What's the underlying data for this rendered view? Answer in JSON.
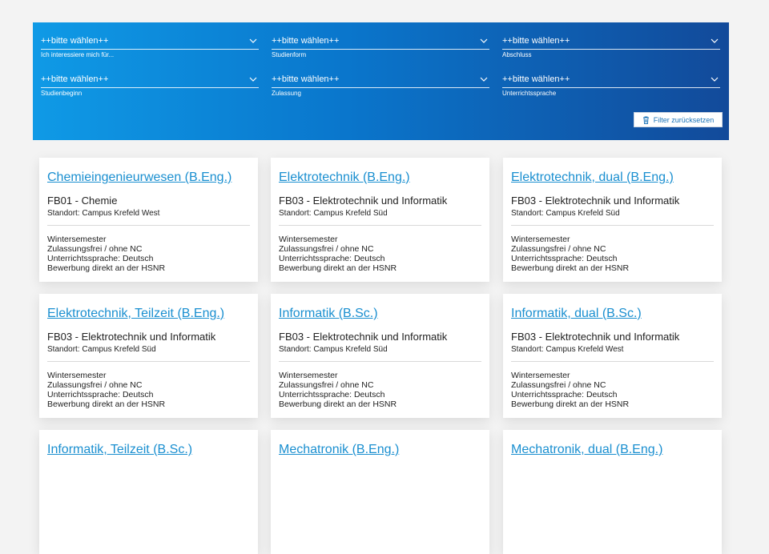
{
  "filters": [
    {
      "value": "++bitte wählen++",
      "label": "Ich interessiere mich für..."
    },
    {
      "value": "++bitte wählen++",
      "label": "Studienform"
    },
    {
      "value": "++bitte wählen++",
      "label": "Abschluss"
    },
    {
      "value": "++bitte wählen++",
      "label": "Studienbeginn"
    },
    {
      "value": "++bitte wählen++",
      "label": "Zulassung"
    },
    {
      "value": "++bitte wählen++",
      "label": "Unterrichtssprache"
    }
  ],
  "reset_button": {
    "label": "Filter zurücksetzen",
    "icon": "trash-icon"
  },
  "colors": {
    "gradient_start": "#0f9ae6",
    "gradient_end": "#124a9a",
    "link": "#1a8fd0"
  },
  "programs": [
    {
      "title": "Chemieingenieurwesen (B.Eng.)",
      "faculty": "FB01 - Chemie",
      "location": "Standort: Campus Krefeld West",
      "semester": "Wintersemester",
      "admission": "Zulassungsfrei / ohne NC",
      "language": "Unterrichtssprache: Deutsch",
      "application": "Bewerbung direkt an der HSNR"
    },
    {
      "title": "Elektrotechnik (B.Eng.)",
      "faculty": "FB03 - Elektrotechnik und Informatik",
      "location": "Standort: Campus Krefeld Süd",
      "semester": "Wintersemester",
      "admission": "Zulassungsfrei / ohne NC",
      "language": "Unterrichtssprache: Deutsch",
      "application": "Bewerbung direkt an der HSNR"
    },
    {
      "title": "Elektrotechnik, dual (B.Eng.)",
      "faculty": "FB03 - Elektrotechnik und Informatik",
      "location": "Standort: Campus Krefeld Süd",
      "semester": "Wintersemester",
      "admission": "Zulassungsfrei / ohne NC",
      "language": "Unterrichtssprache: Deutsch",
      "application": "Bewerbung direkt an der HSNR"
    },
    {
      "title": "Elektrotechnik, Teilzeit (B.Eng.)",
      "faculty": "FB03 - Elektrotechnik und Informatik",
      "location": "Standort: Campus Krefeld Süd",
      "semester": "Wintersemester",
      "admission": "Zulassungsfrei / ohne NC",
      "language": "Unterrichtssprache: Deutsch",
      "application": "Bewerbung direkt an der HSNR"
    },
    {
      "title": "Informatik (B.Sc.)",
      "faculty": "FB03 - Elektrotechnik und Informatik",
      "location": "Standort: Campus Krefeld Süd",
      "semester": "Wintersemester",
      "admission": "Zulassungsfrei / ohne NC",
      "language": "Unterrichtssprache: Deutsch",
      "application": "Bewerbung direkt an der HSNR"
    },
    {
      "title": "Informatik, dual (B.Sc.)",
      "faculty": "FB03 - Elektrotechnik und Informatik",
      "location": "Standort: Campus Krefeld West",
      "semester": "Wintersemester",
      "admission": "Zulassungsfrei / ohne NC",
      "language": "Unterrichtssprache: Deutsch",
      "application": "Bewerbung direkt an der HSNR"
    },
    {
      "title": "Informatik, Teilzeit (B.Sc.)"
    },
    {
      "title": "Mechatronik (B.Eng.)"
    },
    {
      "title": "Mechatronik, dual (B.Eng.)"
    }
  ]
}
